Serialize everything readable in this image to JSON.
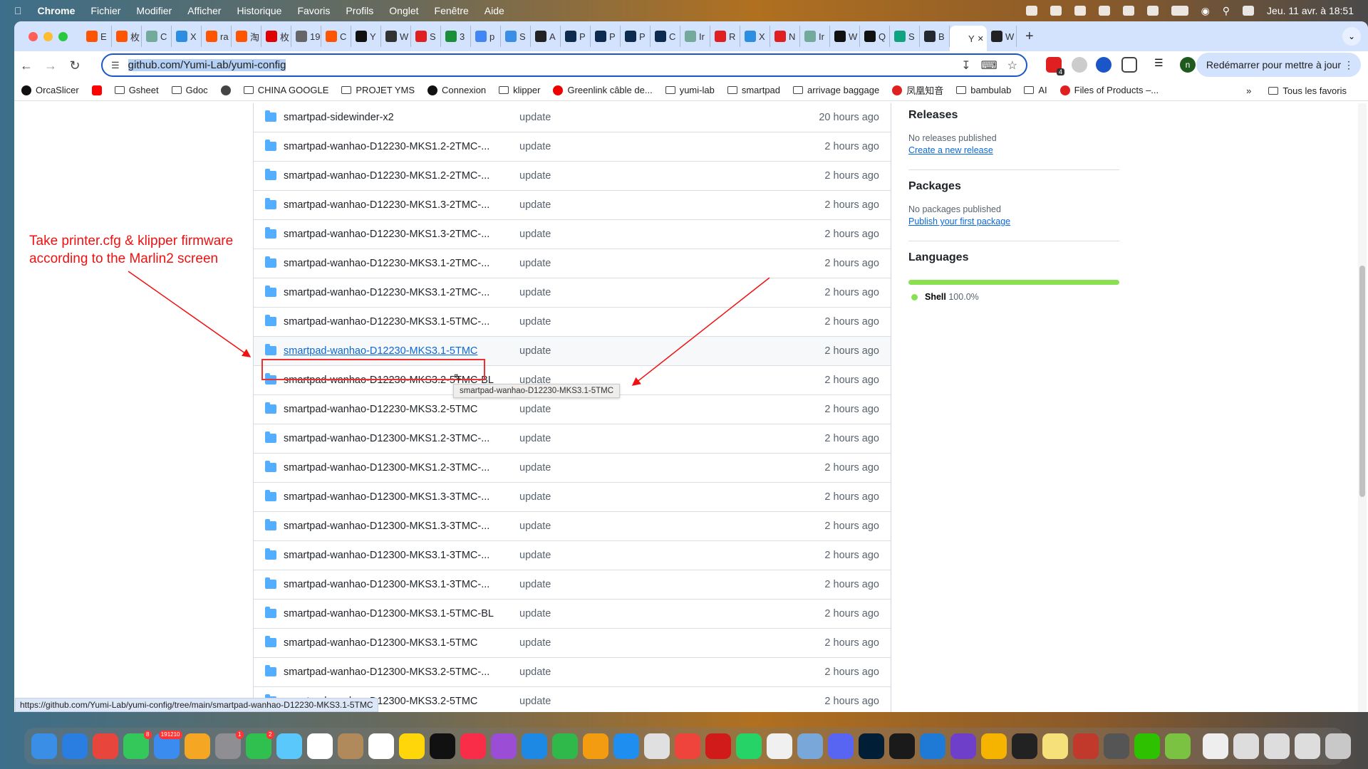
{
  "menubar": {
    "app": "Chrome",
    "items": [
      "Fichier",
      "Modifier",
      "Afficher",
      "Historique",
      "Favoris",
      "Profils",
      "Onglet",
      "Fenêtre",
      "Aide"
    ],
    "clock": "Jeu. 11 avr. à 18:51"
  },
  "tabs": [
    {
      "label": "E",
      "color": "#ff5500"
    },
    {
      "label": "枚",
      "color": "#ff5500"
    },
    {
      "label": "C",
      "color": "#74aa9c"
    },
    {
      "label": "X",
      "color": "#2b8ee0"
    },
    {
      "label": "ra",
      "color": "#ff5500"
    },
    {
      "label": "淘",
      "color": "#ff5500"
    },
    {
      "label": "枚",
      "color": "#e00000"
    },
    {
      "label": "19",
      "color": "#666666"
    },
    {
      "label": "C",
      "color": "#ff5500"
    },
    {
      "label": "Y",
      "color": "#111111"
    },
    {
      "label": "W",
      "color": "#333333"
    },
    {
      "label": "S",
      "color": "#e02020"
    },
    {
      "label": "3",
      "color": "#1a8f3a"
    },
    {
      "label": "p",
      "color": "#4285f4"
    },
    {
      "label": "S",
      "color": "#3a8ee6"
    },
    {
      "label": "A",
      "color": "#222222"
    },
    {
      "label": "P",
      "color": "#0d2b4e"
    },
    {
      "label": "P",
      "color": "#0d2b4e"
    },
    {
      "label": "P",
      "color": "#0d2b4e"
    },
    {
      "label": "C",
      "color": "#0d2b4e"
    },
    {
      "label": "Ir",
      "color": "#74aa9c"
    },
    {
      "label": "R",
      "color": "#e02020"
    },
    {
      "label": "X",
      "color": "#2b8ee0"
    },
    {
      "label": "N",
      "color": "#e02020"
    },
    {
      "label": "Ir",
      "color": "#74aa9c"
    },
    {
      "label": "W",
      "color": "#111111"
    },
    {
      "label": "Q",
      "color": "#111111"
    },
    {
      "label": "S",
      "color": "#10a37f"
    },
    {
      "label": "B",
      "color": "#24292f"
    },
    {
      "label": "Y",
      "color": "#ffffff",
      "active": true
    },
    {
      "label": "W",
      "color": "#222222"
    }
  ],
  "toolbar": {
    "url": "github.com/Yumi-Lab/yumi-config",
    "restart": "Redémarrer pour mettre à jour",
    "ext_badge": "4",
    "profile": "n"
  },
  "bookmarks": [
    {
      "label": "OrcaSlicer",
      "icon": "github-icon"
    },
    {
      "label": "",
      "icon": "youtube-icon"
    },
    {
      "label": "Gsheet",
      "icon": "folder-icon"
    },
    {
      "label": "Gdoc",
      "icon": "folder-icon"
    },
    {
      "label": "",
      "icon": "globe-icon"
    },
    {
      "label": "CHINA GOOGLE",
      "icon": "folder-icon"
    },
    {
      "label": "PROJET YMS",
      "icon": "folder-icon"
    },
    {
      "label": "Connexion",
      "icon": "s-icon"
    },
    {
      "label": "klipper",
      "icon": "folder-icon"
    },
    {
      "label": "Greenlink câble de...",
      "icon": "t-icon"
    },
    {
      "label": "yumi-lab",
      "icon": "folder-icon"
    },
    {
      "label": "smartpad",
      "icon": "folder-icon"
    },
    {
      "label": "arrivage baggage",
      "icon": "folder-icon"
    },
    {
      "label": "凤凰知音",
      "icon": "airchina-icon"
    },
    {
      "label": "bambulab",
      "icon": "folder-icon"
    },
    {
      "label": "AI",
      "icon": "folder-icon"
    },
    {
      "label": "Files of Products –...",
      "icon": "lips-icon"
    }
  ],
  "bookmarks_more": "»",
  "bookmarks_all": "Tous les favoris",
  "files": [
    {
      "name": "smartpad-sidewinder-x2",
      "msg": "update",
      "time": "20 hours ago"
    },
    {
      "name": "smartpad-wanhao-D12230-MKS1.2-2TMC-...",
      "msg": "update",
      "time": "2 hours ago"
    },
    {
      "name": "smartpad-wanhao-D12230-MKS1.2-2TMC-...",
      "msg": "update",
      "time": "2 hours ago"
    },
    {
      "name": "smartpad-wanhao-D12230-MKS1.3-2TMC-...",
      "msg": "update",
      "time": "2 hours ago"
    },
    {
      "name": "smartpad-wanhao-D12230-MKS1.3-2TMC-...",
      "msg": "update",
      "time": "2 hours ago"
    },
    {
      "name": "smartpad-wanhao-D12230-MKS3.1-2TMC-...",
      "msg": "update",
      "time": "2 hours ago"
    },
    {
      "name": "smartpad-wanhao-D12230-MKS3.1-2TMC-...",
      "msg": "update",
      "time": "2 hours ago"
    },
    {
      "name": "smartpad-wanhao-D12230-MKS3.1-5TMC-...",
      "msg": "update",
      "time": "2 hours ago"
    },
    {
      "name": "smartpad-wanhao-D12230-MKS3.1-5TMC",
      "msg": "update",
      "time": "2 hours ago",
      "hovered": true
    },
    {
      "name": "smartpad-wanhao-D12230-MKS3.2-5TMC-BL",
      "msg": "update",
      "time": "2 hours ago"
    },
    {
      "name": "smartpad-wanhao-D12230-MKS3.2-5TMC",
      "msg": "update",
      "time": "2 hours ago"
    },
    {
      "name": "smartpad-wanhao-D12300-MKS1.2-3TMC-...",
      "msg": "update",
      "time": "2 hours ago"
    },
    {
      "name": "smartpad-wanhao-D12300-MKS1.2-3TMC-...",
      "msg": "update",
      "time": "2 hours ago"
    },
    {
      "name": "smartpad-wanhao-D12300-MKS1.3-3TMC-...",
      "msg": "update",
      "time": "2 hours ago"
    },
    {
      "name": "smartpad-wanhao-D12300-MKS1.3-3TMC-...",
      "msg": "update",
      "time": "2 hours ago"
    },
    {
      "name": "smartpad-wanhao-D12300-MKS3.1-3TMC-...",
      "msg": "update",
      "time": "2 hours ago"
    },
    {
      "name": "smartpad-wanhao-D12300-MKS3.1-3TMC-...",
      "msg": "update",
      "time": "2 hours ago"
    },
    {
      "name": "smartpad-wanhao-D12300-MKS3.1-5TMC-BL",
      "msg": "update",
      "time": "2 hours ago"
    },
    {
      "name": "smartpad-wanhao-D12300-MKS3.1-5TMC",
      "msg": "update",
      "time": "2 hours ago"
    },
    {
      "name": "smartpad-wanhao-D12300-MKS3.2-5TMC-...",
      "msg": "update",
      "time": "2 hours ago"
    },
    {
      "name": "smartpad-wanhao-D12300-MKS3.2-5TMC",
      "msg": "update",
      "time": "2 hours ago"
    }
  ],
  "tooltip": "smartpad-wanhao-D12230-MKS3.1-5TMC",
  "annotation": {
    "line1": "Take printer.cfg & klipper firmware",
    "line2": "according to the Marlin2 screen",
    "color": "#f01010"
  },
  "sidebar": {
    "releases": {
      "title": "Releases",
      "text": "No releases published",
      "link": "Create a new release"
    },
    "packages": {
      "title": "Packages",
      "text": "No packages published",
      "link": "Publish your first package"
    },
    "languages": {
      "title": "Languages",
      "items": [
        {
          "name": "Shell",
          "percent": "100.0%",
          "value": 100,
          "color": "#89e051"
        }
      ]
    }
  },
  "status_url": "https://github.com/Yumi-Lab/yumi-config/tree/main/smartpad-wanhao-D12230-MKS3.1-5TMC",
  "dock": [
    {
      "name": "finder",
      "color": "#3a8ee6"
    },
    {
      "name": "safari",
      "color": "#2a7de1"
    },
    {
      "name": "chrome",
      "color": "#e8453c"
    },
    {
      "name": "messages",
      "color": "#34c759",
      "badge": "8"
    },
    {
      "name": "mail",
      "color": "#3b8cf0",
      "badge": "191210"
    },
    {
      "name": "photos",
      "color": "#f5a623"
    },
    {
      "name": "settings",
      "color": "#8e8e93",
      "badge": "1"
    },
    {
      "name": "facetime",
      "color": "#30c04f",
      "badge": "2"
    },
    {
      "name": "maps",
      "color": "#5ac8fa"
    },
    {
      "name": "calendar",
      "color": "#ffffff"
    },
    {
      "name": "contacts",
      "color": "#b08a5a"
    },
    {
      "name": "reminders",
      "color": "#ffffff"
    },
    {
      "name": "notes",
      "color": "#ffd60a"
    },
    {
      "name": "tv",
      "color": "#111111"
    },
    {
      "name": "music",
      "color": "#fa2d48"
    },
    {
      "name": "podcasts",
      "color": "#9b4dd6"
    },
    {
      "name": "keynote",
      "color": "#1e88e5"
    },
    {
      "name": "numbers",
      "color": "#2fb94a"
    },
    {
      "name": "pages",
      "color": "#f39c12"
    },
    {
      "name": "appstore",
      "color": "#1f8ef1"
    },
    {
      "name": "launchpad",
      "color": "#e0e0e0"
    },
    {
      "name": "anydesk",
      "color": "#ef443b"
    },
    {
      "name": "acrobat",
      "color": "#d11a1a"
    },
    {
      "name": "whatsapp",
      "color": "#25d366"
    },
    {
      "name": "textedit",
      "color": "#f0f0f0"
    },
    {
      "name": "preview",
      "color": "#7aa7d9"
    },
    {
      "name": "discord",
      "color": "#5865f2"
    },
    {
      "name": "photoshop",
      "color": "#001e36"
    },
    {
      "name": "terminal",
      "color": "#1a1a1a"
    },
    {
      "name": "vscode",
      "color": "#1e7ad4"
    },
    {
      "name": "github-desktop",
      "color": "#6e40c9"
    },
    {
      "name": "cyberduck",
      "color": "#f5b400"
    },
    {
      "name": "inkscape",
      "color": "#222222"
    },
    {
      "name": "stickies",
      "color": "#f5e07a"
    },
    {
      "name": "krita",
      "color": "#c0392b"
    },
    {
      "name": "paper-plane",
      "color": "#555555"
    },
    {
      "name": "wechat",
      "color": "#2dc100"
    },
    {
      "name": "cube",
      "color": "#7cc242"
    },
    {
      "name": "file",
      "color": "#eeeeee",
      "sep": true
    },
    {
      "name": "screenshot1",
      "color": "#dddddd"
    },
    {
      "name": "screenshot2",
      "color": "#dddddd"
    },
    {
      "name": "screenshot3",
      "color": "#dddddd"
    },
    {
      "name": "trash",
      "color": "#c8c8c8"
    }
  ]
}
